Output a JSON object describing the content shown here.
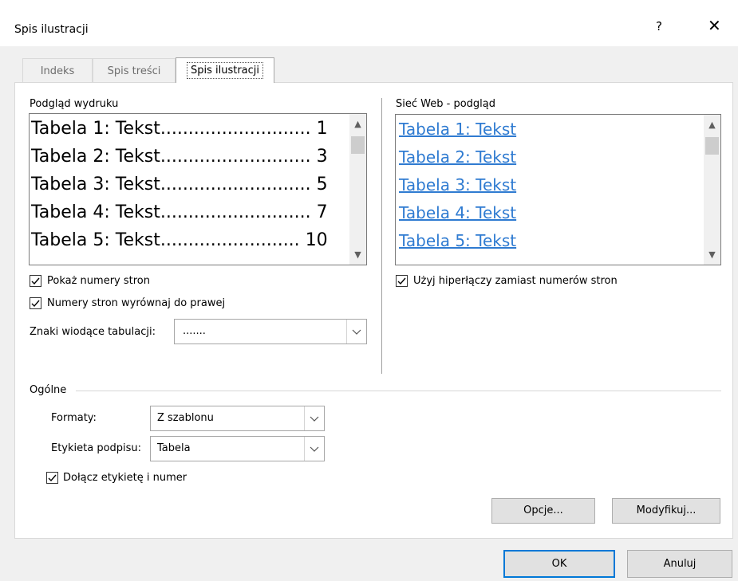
{
  "window": {
    "title": "Spis ilustracji",
    "help_label": "?",
    "close_label": "✕"
  },
  "tabs": [
    {
      "label": "Indeks"
    },
    {
      "label": "Spis treści"
    },
    {
      "label": "Spis ilustracji"
    }
  ],
  "print_preview": {
    "label": "Podgląd wydruku",
    "lines": [
      {
        "text": "Tabela 1: Tekst",
        "dots": "...........................",
        "page": "1"
      },
      {
        "text": "Tabela 2: Tekst",
        "dots": "...........................",
        "page": "3"
      },
      {
        "text": "Tabela 3: Tekst",
        "dots": "...........................",
        "page": "5"
      },
      {
        "text": "Tabela 4: Tekst",
        "dots": "...........................",
        "page": "7"
      },
      {
        "text": "Tabela 5: Tekst",
        "dots": ".........................",
        "page": "10"
      }
    ]
  },
  "web_preview": {
    "label": "Sieć Web - podgląd",
    "lines": [
      "Tabela 1: Tekst",
      "Tabela 2: Tekst",
      "Tabela 3: Tekst",
      "Tabela 4: Tekst",
      "Tabela 5: Tekst"
    ]
  },
  "options": {
    "show_page_numbers": {
      "label": "Pokaż numery stron",
      "checked": true
    },
    "right_align": {
      "label": "Numery stron wyrównaj do prawej",
      "checked": true
    },
    "use_hyperlinks": {
      "label": "Użyj hiperłączy zamiast numerów stron",
      "checked": true
    },
    "tab_leader": {
      "label": "Znaki wiodące tabulacji:",
      "value": "......."
    }
  },
  "general": {
    "label": "Ogólne",
    "formats": {
      "label": "Formaty:",
      "value": "Z szablonu"
    },
    "caption_label": {
      "label": "Etykieta podpisu:",
      "value": "Tabela"
    },
    "include_label": {
      "label": "Dołącz etykietę i numer",
      "checked": true
    }
  },
  "buttons": {
    "options": "Opcje...",
    "modify": "Modyfikuj...",
    "ok": "OK",
    "cancel": "Anuluj"
  }
}
